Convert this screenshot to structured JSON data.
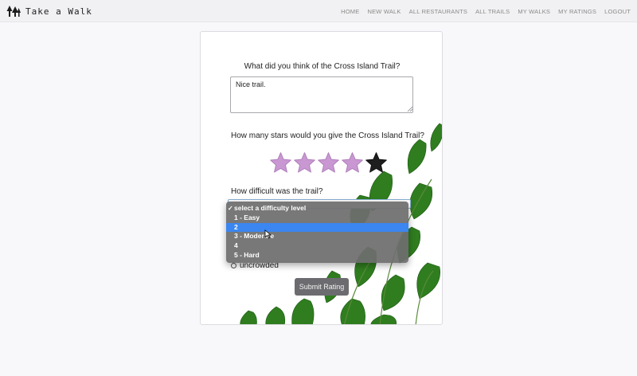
{
  "brand": {
    "name": "Take a Walk",
    "icon": "trees-icon"
  },
  "nav": {
    "links": [
      "HOME",
      "NEW WALK",
      "ALL RESTAURANTS",
      "ALL TRAILS",
      "MY WALKS",
      "MY RATINGS",
      "LOGOUT"
    ]
  },
  "form": {
    "review_question": "What did you think of the Cross Island Trail?",
    "review_value": "Nice trail.",
    "stars_question": "How many stars would you give the Cross Island Trail?",
    "stars_selected": 4,
    "stars_total": 5,
    "difficulty_question": "How difficult was the trail?",
    "difficulty_options": [
      "select a difficulty level",
      "1 - Easy",
      "2",
      "3 - Moderate",
      "4",
      "5 - Hard"
    ],
    "difficulty_checked_index": 0,
    "difficulty_highlighted_index": 2,
    "crowd_option": "uncrowded",
    "submit_label": "Submit Rating"
  },
  "colors": {
    "star_filled": "#c998d2",
    "star_empty": "#1e1e1e",
    "highlight": "#3b86f0",
    "submit_bg": "#6c6c70"
  }
}
